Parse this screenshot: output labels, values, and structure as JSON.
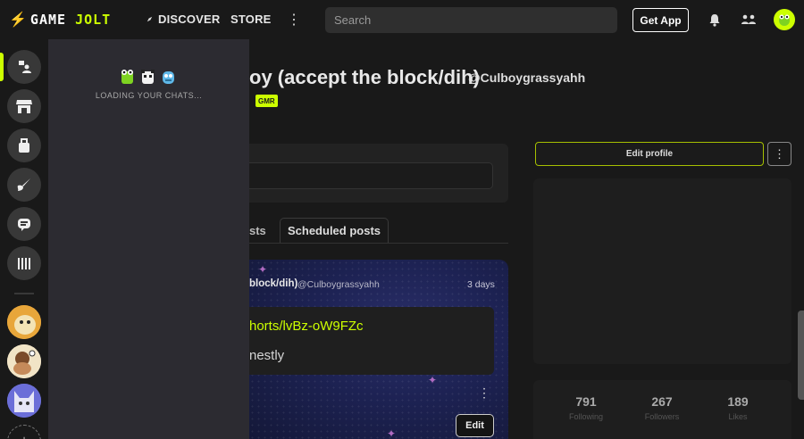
{
  "header": {
    "logo_game": "GAME",
    "logo_jolt": "JOLT",
    "nav_discover": "DISCOVER",
    "nav_store": "STORE",
    "nav_more": "⋮",
    "search_placeholder": "Search",
    "get_app": "Get App"
  },
  "chat": {
    "loading_text": "LOADING YOUR CHATS..."
  },
  "profile": {
    "title": "oy (accept the block/dih)",
    "handle": "@Culboygrassyahh",
    "badge": "GMR"
  },
  "tabs": {
    "posts_label": "sts",
    "scheduled_label": "Scheduled posts"
  },
  "post": {
    "author": "block/dih)",
    "handle": "@Culboygrassyahh",
    "time": "3 days",
    "link": "horts/lvBz-oW9FZc",
    "text": "nestly",
    "more": "⋮",
    "edit_label": "Edit"
  },
  "sidebar": {
    "edit_profile_label": "Edit profile",
    "more": "⋮"
  },
  "stats": [
    {
      "value": "791",
      "label": "Following"
    },
    {
      "value": "267",
      "label": "Followers"
    },
    {
      "value": "189",
      "label": "Likes"
    }
  ],
  "colors": {
    "accent": "#ccff00",
    "background": "#191919",
    "chat_panel": "#2c2b31"
  }
}
